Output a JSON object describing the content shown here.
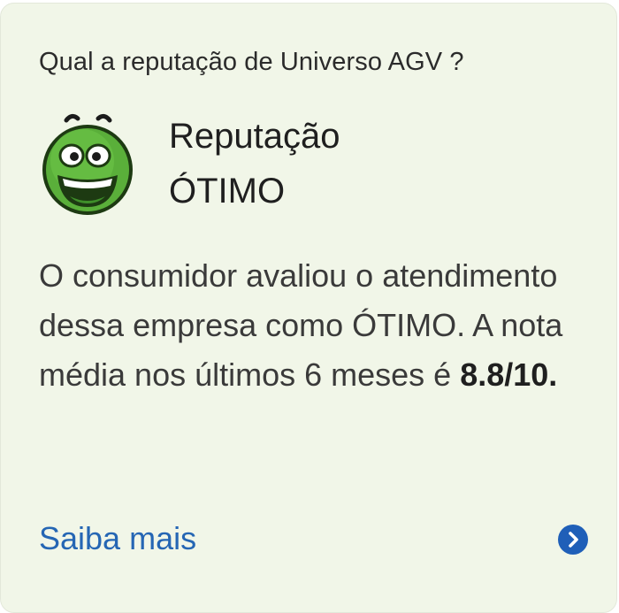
{
  "card": {
    "question": "Qual a reputação de Universo AGV ?",
    "reputation_label": "Reputação",
    "reputation_value": "ÓTIMO",
    "description_prefix": "O consumidor avaliou o atendimento dessa empresa como ÓTIMO. A nota média nos últimos 6 meses é ",
    "score": "8.8/10.",
    "link_label": "Saiba mais",
    "link_icon": "chevron-right-circle-icon",
    "face_icon": "happy-face-icon"
  },
  "colors": {
    "card_background": "#f1f6e8",
    "link": "#2566b4",
    "chevron_button": "#1f5fb8",
    "face_green": "#5aaf3a"
  }
}
